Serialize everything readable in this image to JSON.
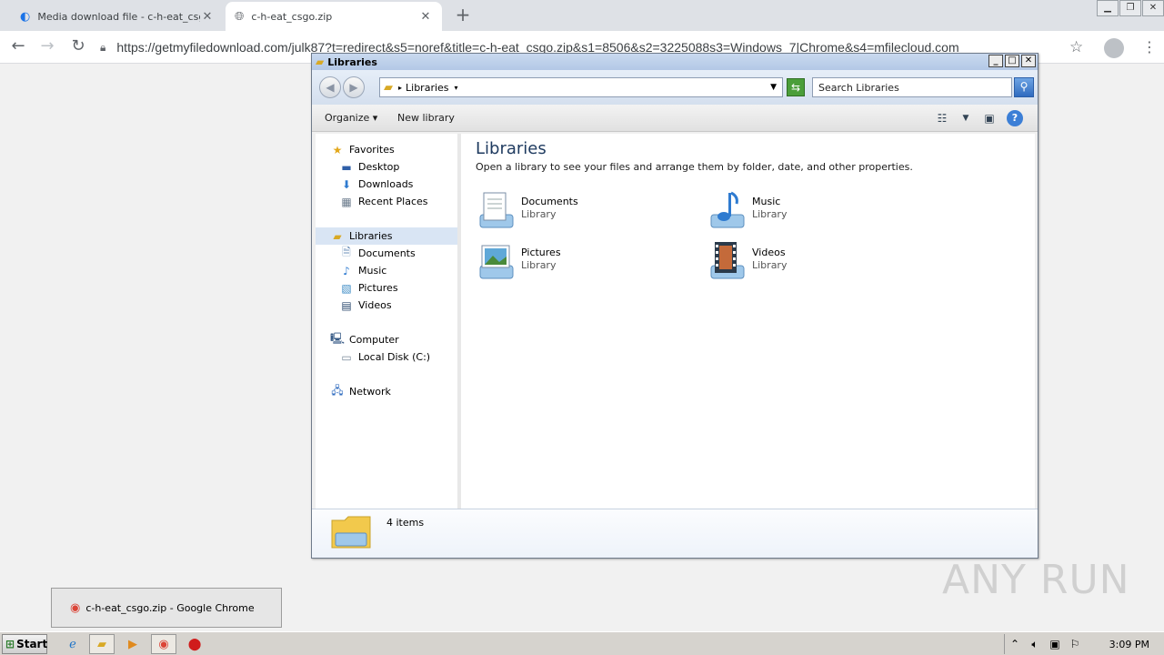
{
  "chrome": {
    "tabs": [
      {
        "title": "Media download file - c-h-eat_csgo.z",
        "active": false
      },
      {
        "title": "c-h-eat_csgo.zip",
        "active": true
      }
    ],
    "new_tab": "+",
    "url": "https://getmyfiledownload.com/julk87?t=redirect&s5=noref&title=c-h-eat_csgo.zip&s1=8506&s2=3225088s3=Windows_7|Chrome&s4=mfilecloud.com"
  },
  "explorer": {
    "title": "Libraries",
    "address_crumb": "Libraries",
    "search_placeholder": "Search Libraries",
    "commands": {
      "organize": "Organize",
      "new_library": "New library"
    },
    "nav": {
      "favorites": "Favorites",
      "desktop": "Desktop",
      "downloads": "Downloads",
      "recent": "Recent Places",
      "libraries": "Libraries",
      "documents": "Documents",
      "music": "Music",
      "pictures": "Pictures",
      "videos": "Videos",
      "computer": "Computer",
      "local_disk": "Local Disk (C:)",
      "network": "Network"
    },
    "content": {
      "heading": "Libraries",
      "subtitle": "Open a library to see your files and arrange them by folder, date, and other properties.",
      "libraries": [
        {
          "name": "Documents",
          "kind": "Library"
        },
        {
          "name": "Music",
          "kind": "Library"
        },
        {
          "name": "Pictures",
          "kind": "Library"
        },
        {
          "name": "Videos",
          "kind": "Library"
        }
      ]
    },
    "details": {
      "count": "4 items"
    }
  },
  "taskbar": {
    "start": "Start",
    "popup_label": "c-h-eat_csgo.zip - Google Chrome",
    "clock": "3:09 PM"
  },
  "watermark": "ANY RUN"
}
